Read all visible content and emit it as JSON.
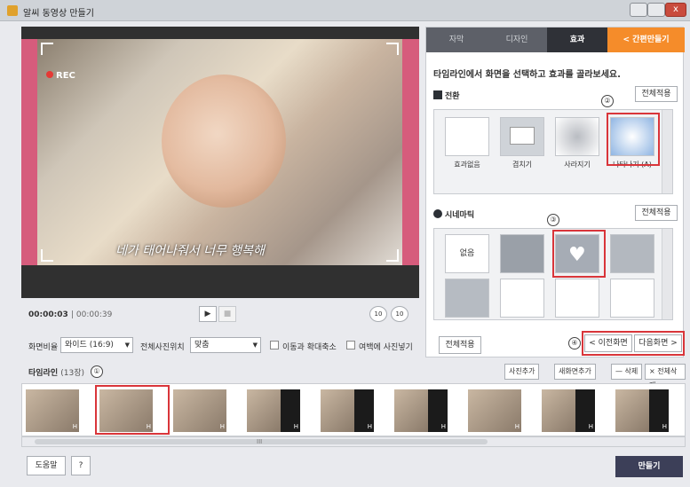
{
  "window": {
    "title": "알씨 동영상 만들기",
    "close_glyph": "x"
  },
  "preview": {
    "rec_label": "REC",
    "caption": "네가 태어나줘서 너무 행복해",
    "time_current": "00:00:03",
    "time_total": "| 00:00:39",
    "play_icon": "▶",
    "stop_icon": "■",
    "rewind_label": "10",
    "forward_label": "10"
  },
  "settings": {
    "aspect_label": "화면비율",
    "aspect_value": "와이드 (16:9)",
    "photo_position_label": "전체사진위치",
    "photo_position_value": "맞춤",
    "move_zoom_label": "이동과 확대축소",
    "margin_fill_label": "여백에 사진넣기",
    "dropdown_glyph": "▼"
  },
  "panel": {
    "tabs": [
      {
        "label": "자막"
      },
      {
        "label": "디자인"
      },
      {
        "label": "효과"
      }
    ],
    "easy_make_label": "< 간편만들기",
    "instruction": "타임라인에서 화면을 선택하고 효과를 골라보세요.",
    "transition": {
      "title": "전환",
      "apply_label": "전체적용",
      "items": [
        {
          "label": "효과없음"
        },
        {
          "label": "겹치기"
        },
        {
          "label": "사라지기"
        },
        {
          "label": "나타나기 (A)"
        }
      ]
    },
    "cinematic": {
      "title": "시네마틱",
      "apply_label": "전체적용",
      "none_label": "없음"
    },
    "apply_all_label": "전체적용",
    "prev_label": "< 이전화면",
    "next_label": "다음화면 >"
  },
  "timeline": {
    "title": "타임라인",
    "count": "(13장)",
    "add_photo_label": "사진추가",
    "add_screen_label": "새화면추가",
    "delete_label": "— 삭제",
    "delete_all_label": "× 전체삭제",
    "scroll_mark": "III",
    "frame_mark": "H"
  },
  "footer": {
    "help_label": "도움말",
    "question_label": "?",
    "make_label": "만들기"
  },
  "callouts": {
    "n1": "①",
    "n2": "②",
    "n3": "③",
    "n4": "④"
  },
  "colors": {
    "accent_orange": "#f58c2a",
    "highlight_red": "#d9353a",
    "frame_pink": "#d65c7c",
    "make_button": "#3c3f58"
  }
}
